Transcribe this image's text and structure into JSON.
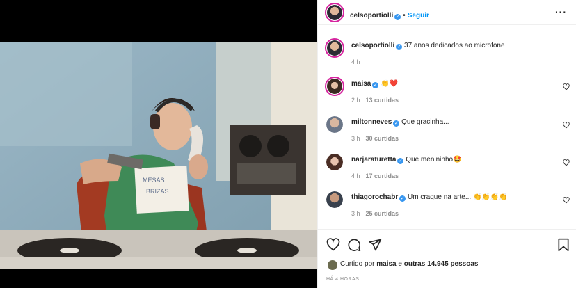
{
  "post": {
    "author": "celsoportiolli",
    "follow_label": "Seguir",
    "caption": "37 anos dedicados ao microfone",
    "caption_time": "4 h"
  },
  "comments": [
    {
      "user": "maisa",
      "text": "👏❤️",
      "time": "2 h",
      "likes": "13 curtidas"
    },
    {
      "user": "miltonneves",
      "text": "Que gracinha...",
      "time": "3 h",
      "likes": "30 curtidas"
    },
    {
      "user": "narjaraturetta",
      "text": "Que menininho🤩",
      "time": "4 h",
      "likes": "17 curtidas"
    },
    {
      "user": "thiagorochabr",
      "text": "Um craque na arte... 👏👏👏👏",
      "time": "3 h",
      "likes": "25 curtidas"
    }
  ],
  "liked_by": {
    "prefix": "Curtido por",
    "user": "maisa",
    "middle": "e",
    "others": "outras 14.945 pessoas"
  },
  "time_ago": "HÁ 4 HORAS",
  "photo": {
    "sign_line1": "MESAS",
    "sign_line2": "BRIZAS"
  },
  "colors": {
    "accent": "#0095f6",
    "verified": "#3897f0",
    "muted": "#8e8e8e"
  },
  "icons": [
    "more-options-icon",
    "verified-icon",
    "heart-icon",
    "comment-icon",
    "share-icon",
    "bookmark-icon"
  ]
}
